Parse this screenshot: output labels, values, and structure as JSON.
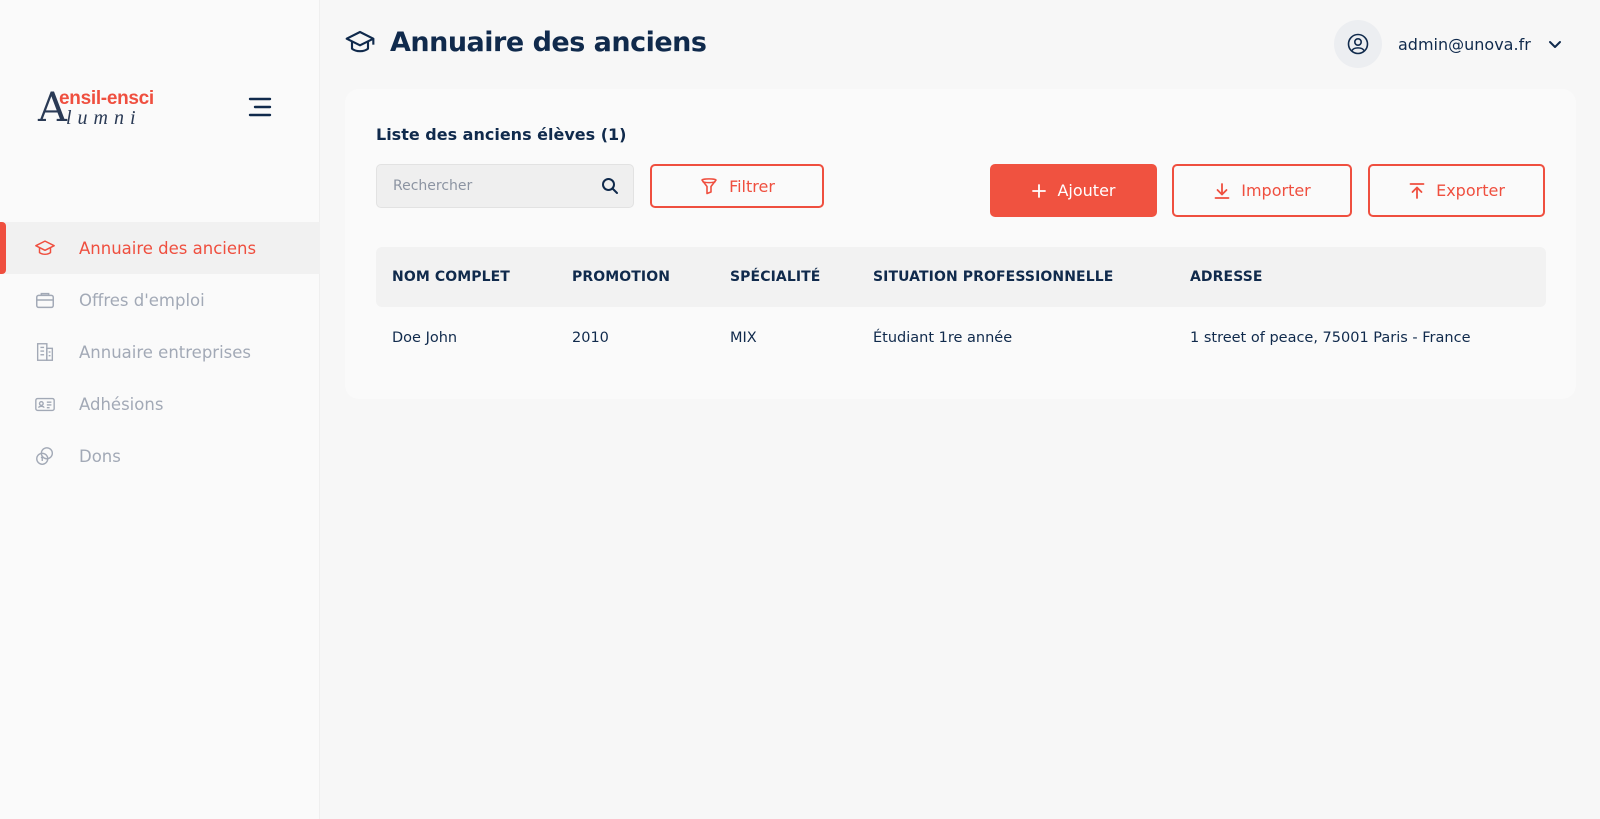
{
  "brand": {
    "logo_top": "ensil-ensci",
    "logo_letter": "A",
    "logo_bottom": "lumni"
  },
  "sidebar": {
    "items": [
      {
        "label": "Annuaire des anciens",
        "icon": "graduation-cap-icon",
        "active": true
      },
      {
        "label": "Offres d'emploi",
        "icon": "briefcase-icon",
        "active": false
      },
      {
        "label": "Annuaire entreprises",
        "icon": "building-icon",
        "active": false
      },
      {
        "label": "Adhésions",
        "icon": "id-card-icon",
        "active": false
      },
      {
        "label": "Dons",
        "icon": "coins-icon",
        "active": false
      }
    ]
  },
  "header": {
    "title": "Annuaire des anciens",
    "user_email": "admin@unova.fr"
  },
  "card": {
    "title": "Liste des anciens élèves (1)",
    "search_placeholder": "Rechercher",
    "filter_label": "Filtrer",
    "add_label": "Ajouter",
    "import_label": "Importer",
    "export_label": "Exporter"
  },
  "table": {
    "columns": [
      "NOM COMPLET",
      "PROMOTION",
      "SPÉCIALITÉ",
      "SITUATION PROFESSIONNELLE",
      "ADRESSE"
    ],
    "rows": [
      [
        "Doe John",
        "2010",
        "MIX",
        "Étudiant 1re année",
        "1 street of peace, 75001 Paris - France"
      ]
    ]
  },
  "colors": {
    "accent": "#ef4f3f",
    "text": "#102a4c",
    "muted": "#a2a9b6"
  }
}
